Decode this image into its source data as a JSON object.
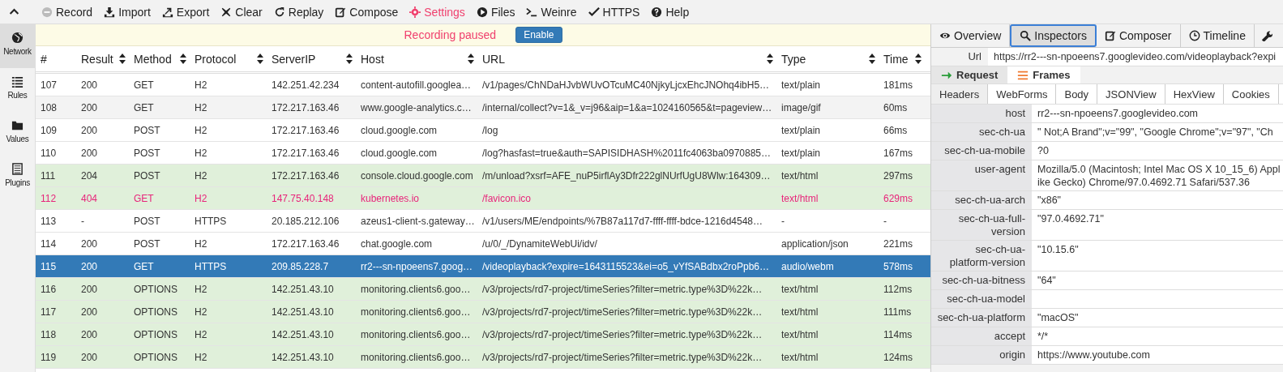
{
  "toolbar": [
    {
      "label": "Record",
      "selected": false
    },
    {
      "label": "Import",
      "selected": false
    },
    {
      "label": "Export",
      "selected": false
    },
    {
      "label": "Clear",
      "selected": false
    },
    {
      "label": "Replay",
      "selected": false
    },
    {
      "label": "Compose",
      "selected": false
    },
    {
      "label": "Settings",
      "selected": true
    },
    {
      "label": "Files",
      "selected": false
    },
    {
      "label": "Weinre",
      "selected": false
    },
    {
      "label": "HTTPS",
      "selected": false
    },
    {
      "label": "Help",
      "selected": false
    }
  ],
  "sidebar": {
    "items": [
      {
        "label": "Network",
        "selected": true
      },
      {
        "label": "Rules",
        "selected": false
      },
      {
        "label": "Values",
        "selected": false
      },
      {
        "label": "Plugins",
        "selected": false
      }
    ]
  },
  "banner": {
    "message": "Recording paused",
    "button": "Enable"
  },
  "table": {
    "columns": [
      {
        "label": "#",
        "sortable": false
      },
      {
        "label": "Result",
        "sortable": true
      },
      {
        "label": "Method",
        "sortable": true
      },
      {
        "label": "Protocol",
        "sortable": true
      },
      {
        "label": "ServerIP",
        "sortable": true
      },
      {
        "label": "Host",
        "sortable": true
      },
      {
        "label": "URL",
        "sortable": true
      },
      {
        "label": "Type",
        "sortable": true
      },
      {
        "label": "Time",
        "sortable": true
      }
    ],
    "rows": [
      {
        "kind": "plain",
        "error": false,
        "selected": false,
        "cells": [
          "107",
          "200",
          "GET",
          "H2",
          "142.251.42.234",
          "content-autofill.googlea…",
          "/v1/pages/ChNDaHJvbWUvOTcuMC40NjkyLjcxEhcJNOhq4ibH5…",
          "text/plain",
          "181ms"
        ]
      },
      {
        "kind": "hover",
        "error": false,
        "selected": false,
        "cells": [
          "108",
          "200",
          "GET",
          "H2",
          "172.217.163.46",
          "www.google-analytics.c…",
          "/internal/collect?v=1&_v=j96&aip=1&a=1024160565&t=pageview…",
          "image/gif",
          "60ms"
        ]
      },
      {
        "kind": "plain",
        "error": false,
        "selected": false,
        "cells": [
          "109",
          "200",
          "POST",
          "H2",
          "172.217.163.46",
          "cloud.google.com",
          "/log",
          "text/plain",
          "66ms"
        ]
      },
      {
        "kind": "plain",
        "error": false,
        "selected": false,
        "cells": [
          "110",
          "200",
          "POST",
          "H2",
          "172.217.163.46",
          "cloud.google.com",
          "/log?hasfast=true&auth=SAPISIDHASH%2011fc4063ba0970885…",
          "text/plain",
          "167ms"
        ]
      },
      {
        "kind": "green",
        "error": false,
        "selected": false,
        "cells": [
          "111",
          "204",
          "POST",
          "H2",
          "172.217.163.46",
          "console.cloud.google.com",
          "/m/unload?xsrf=AFE_nuP5irflAy3Dfr222glNUrfUgU8Wlw:164309…",
          "text/html",
          "297ms"
        ]
      },
      {
        "kind": "green",
        "error": true,
        "selected": false,
        "cells": [
          "112",
          "404",
          "GET",
          "H2",
          "147.75.40.148",
          "kubernetes.io",
          "/favicon.ico",
          "text/html",
          "629ms"
        ]
      },
      {
        "kind": "plain",
        "error": false,
        "selected": false,
        "cells": [
          "113",
          "-",
          "POST",
          "HTTPS",
          "20.185.212.106",
          "azeus1-client-s.gateway…",
          "/v1/users/ME/endpoints/%7B87a117d7-ffff-ffff-bdce-1216d4548…",
          "-",
          "-"
        ]
      },
      {
        "kind": "plain",
        "error": false,
        "selected": false,
        "cells": [
          "114",
          "200",
          "POST",
          "H2",
          "172.217.163.46",
          "chat.google.com",
          "/u/0/_/DynamiteWebUi/idv/",
          "application/json",
          "221ms"
        ]
      },
      {
        "kind": "plain",
        "error": false,
        "selected": true,
        "cells": [
          "115",
          "200",
          "GET",
          "HTTPS",
          "209.85.228.7",
          "rr2---sn-npoeens7.goog…",
          "/videoplayback?expire=1643115523&ei=o5_vYfSABdbx2roPpb6…",
          "audio/webm",
          "578ms"
        ]
      },
      {
        "kind": "green",
        "error": false,
        "selected": false,
        "cells": [
          "116",
          "200",
          "OPTIONS",
          "H2",
          "142.251.43.10",
          "monitoring.clients6.goo…",
          "/v3/projects/rd7-project/timeSeries?filter=metric.type%3D%22k…",
          "text/html",
          "112ms"
        ]
      },
      {
        "kind": "green",
        "error": false,
        "selected": false,
        "cells": [
          "117",
          "200",
          "OPTIONS",
          "H2",
          "142.251.43.10",
          "monitoring.clients6.goo…",
          "/v3/projects/rd7-project/timeSeries?filter=metric.type%3D%22k…",
          "text/html",
          "111ms"
        ]
      },
      {
        "kind": "green",
        "error": false,
        "selected": false,
        "cells": [
          "118",
          "200",
          "OPTIONS",
          "H2",
          "142.251.43.10",
          "monitoring.clients6.goo…",
          "/v3/projects/rd7-project/timeSeries?filter=metric.type%3D%22k…",
          "text/html",
          "114ms"
        ]
      },
      {
        "kind": "green",
        "error": false,
        "selected": false,
        "cells": [
          "119",
          "200",
          "OPTIONS",
          "H2",
          "142.251.43.10",
          "monitoring.clients6.goo…",
          "/v3/projects/rd7-project/timeSeries?filter=metric.type%3D%22k…",
          "text/html",
          "124ms"
        ]
      }
    ]
  },
  "inspector": {
    "tabs": [
      {
        "label": "Overview",
        "selected": false
      },
      {
        "label": "Inspectors",
        "selected": true
      },
      {
        "label": "Composer",
        "selected": false
      },
      {
        "label": "Timeline",
        "selected": false
      }
    ],
    "url": {
      "label": "Url",
      "value": "https://rr2---sn-npoeens7.googlevideo.com/videoplayback?expi"
    },
    "sections": [
      {
        "label": "Request",
        "selected": true
      },
      {
        "label": "Frames",
        "selected": false
      }
    ],
    "subtabs": [
      {
        "label": "Headers",
        "selected": true
      },
      {
        "label": "WebForms",
        "selected": false
      },
      {
        "label": "Body",
        "selected": false
      },
      {
        "label": "JSONView",
        "selected": false
      },
      {
        "label": "HexView",
        "selected": false
      },
      {
        "label": "Cookies",
        "selected": false
      }
    ],
    "headers": [
      {
        "name": "host",
        "value": "rr2---sn-npoeens7.googlevideo.com"
      },
      {
        "name": "sec-ch-ua",
        "value": "\" Not;A Brand\";v=\"99\", \"Google Chrome\";v=\"97\", \"Ch"
      },
      {
        "name": "sec-ch-ua-mobile",
        "value": "?0"
      },
      {
        "name": "user-agent",
        "value": "Mozilla/5.0 (Macintosh; Intel Mac OS X 10_15_6) Appl",
        "value_2": "ike Gecko) Chrome/97.0.4692.71 Safari/537.36"
      },
      {
        "name": "sec-ch-ua-arch",
        "value": "\"x86\""
      },
      {
        "name": "sec-ch-ua-full-version",
        "value": "\"97.0.4692.71\""
      },
      {
        "name": "sec-ch-ua-platform-version",
        "value": "\"10.15.6\""
      },
      {
        "name": "sec-ch-ua-bitness",
        "value": "\"64\""
      },
      {
        "name": "sec-ch-ua-model"
      },
      {
        "name": "sec-ch-ua-platform",
        "value": "\"macOS\""
      },
      {
        "name": "accept",
        "value": "*/*"
      },
      {
        "name": "origin",
        "value": "https://www.youtube.com"
      }
    ]
  }
}
